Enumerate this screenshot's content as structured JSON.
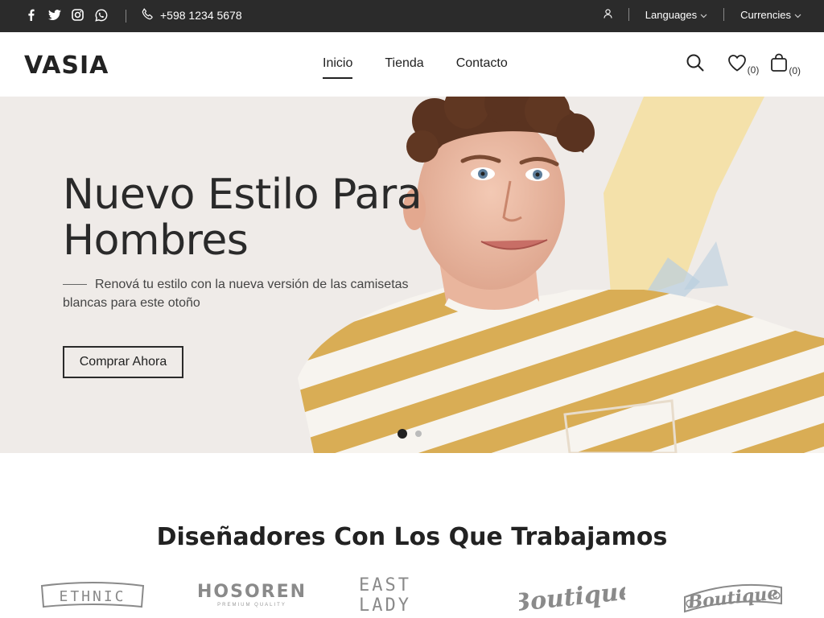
{
  "topbar": {
    "social_icons": [
      "facebook-icon",
      "twitter-icon",
      "instagram-icon",
      "whatsapp-icon"
    ],
    "phone": "+598 1234 5678",
    "languages_label": "Languages",
    "currencies_label": "Currencies"
  },
  "header": {
    "logo": "VASIA",
    "nav": [
      {
        "label": "Inicio",
        "active": true
      },
      {
        "label": "Tienda",
        "active": false
      },
      {
        "label": "Contacto",
        "active": false
      }
    ],
    "wishlist_count": "(0)",
    "cart_count": "(0)"
  },
  "hero": {
    "title": "Nuevo Estilo Para Hombres",
    "subtitle": "Renová tu estilo con la nueva versión de las camisetas blancas para este otoño",
    "button_label": "Comprar Ahora",
    "slides_total": 2,
    "slide_active": 1
  },
  "designers": {
    "title": "Diseñadores Con Los Que Trabajamos",
    "brands": [
      "ETHNIC",
      "HOSOREN",
      "PREMIUM QUALITY",
      "EAST LADY",
      "Boutique",
      "Boutique"
    ]
  },
  "colors": {
    "topbar_bg": "#2b2b2b",
    "hero_bg": "#efebe8",
    "shirt_stripe": "#d9ad55"
  }
}
